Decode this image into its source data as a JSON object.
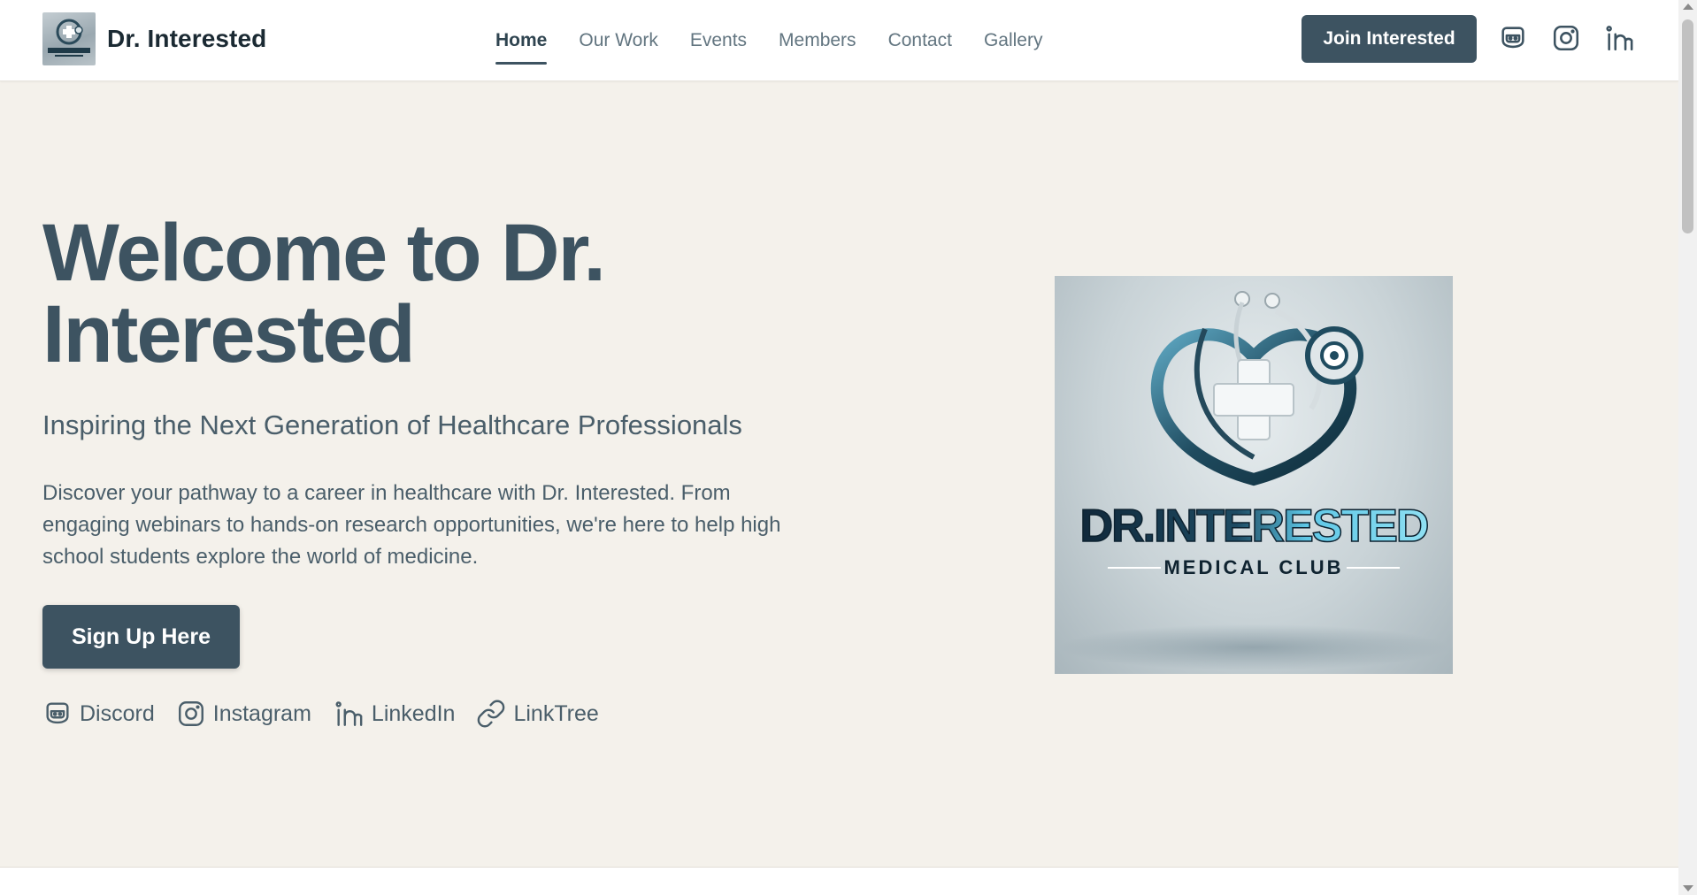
{
  "header": {
    "brand_name": "Dr. Interested",
    "nav": [
      {
        "label": "Home",
        "active": true
      },
      {
        "label": "Our Work",
        "active": false
      },
      {
        "label": "Events",
        "active": false
      },
      {
        "label": "Members",
        "active": false
      },
      {
        "label": "Contact",
        "active": false
      },
      {
        "label": "Gallery",
        "active": false
      }
    ],
    "join_label": "Join Interested",
    "icons": [
      "discord-icon",
      "instagram-icon",
      "linkedin-icon"
    ]
  },
  "hero": {
    "title_line1": "Welcome to Dr.",
    "title_line2": "Interested",
    "subtitle": "Inspiring the Next Generation of Healthcare Professionals",
    "description": "Discover your pathway to a career in healthcare with Dr. Interested. From engaging webinars to hands-on research opportunities, we're here to help high school students explore the world of medicine.",
    "signup_label": "Sign Up Here",
    "social_links": [
      {
        "label": "Discord",
        "icon": "discord-icon"
      },
      {
        "label": "Instagram",
        "icon": "instagram-icon"
      },
      {
        "label": "LinkedIn",
        "icon": "linkedin-icon"
      },
      {
        "label": "LinkTree",
        "icon": "link-icon"
      }
    ]
  },
  "logo_image": {
    "brand_text": "DR.INTERESTED",
    "tagline": "MEDICAL CLUB"
  },
  "colors": {
    "primary": "#3d5361",
    "background": "#f4f1eb",
    "header_bg": "#ffffff"
  }
}
